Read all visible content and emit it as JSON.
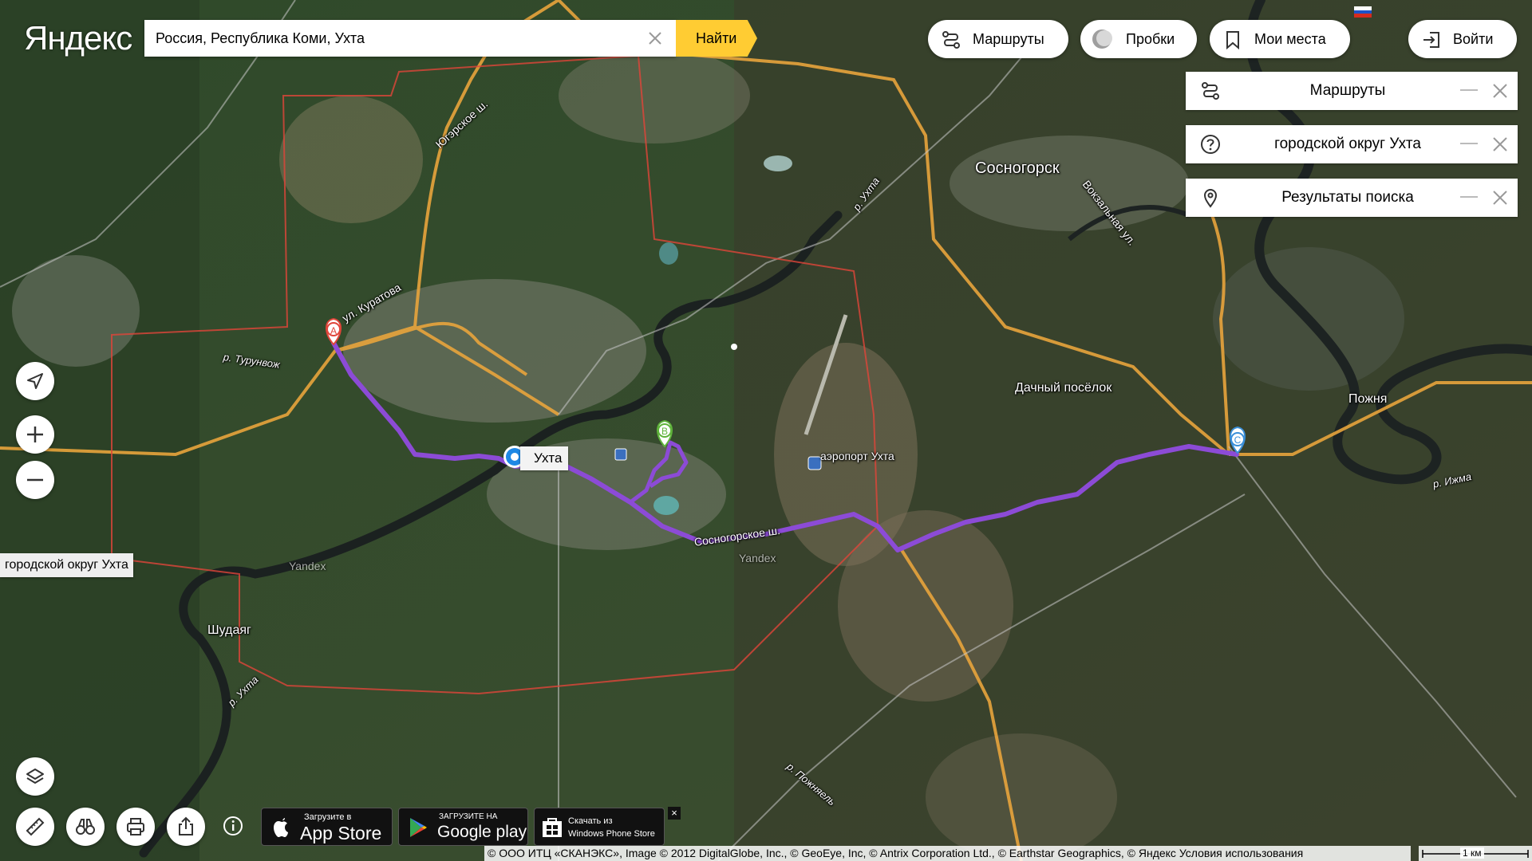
{
  "logo": "Яндекс",
  "search": {
    "value": "Россия, Республика Коми, Ухта",
    "button_label": "Найти"
  },
  "toolbar": {
    "routes_label": "Маршруты",
    "traffic_label": "Пробки",
    "myplaces_label": "Мои места",
    "login_label": "Войти"
  },
  "panels": [
    {
      "label": "Маршруты",
      "icon": "route-icon"
    },
    {
      "label": "городской округ Ухта",
      "icon": "question-icon"
    },
    {
      "label": "Результаты поиска",
      "icon": "pin-icon"
    }
  ],
  "map": {
    "mode": "satellite",
    "colors": {
      "route": "#8c4bd6",
      "road": "#e8a43c",
      "boundary": "#e0453a",
      "river": "#1b2120"
    },
    "city_pin_label": "Ухта",
    "region_label": "городской округ Ухта",
    "waypoints": [
      "A",
      "B",
      "C"
    ],
    "labels": {
      "sosnogorsk": "Сосногорск",
      "dachny": "Дачный посёлок",
      "pozhnya": "Пожня",
      "shudayag": "Шудаяг",
      "airport": "аэропорт Ухта",
      "kuratova": "ул. Куратова",
      "yugerskoe": "Югэрское ш.",
      "sosnogorskoe": "Сосногорское ш.",
      "vokzalnaya": "Вокзальная ул.",
      "turunvozh": "р. Турунвож",
      "ukhta_river1": "р. Ухта",
      "ukhta_river2": "р. Ухта",
      "izhma": "р. Ижма",
      "pozhnyael": "р. Пожняель",
      "yandex1": "Yandex",
      "yandex2": "Yandex"
    }
  },
  "stores": {
    "appstore_small": "Загрузите в",
    "appstore_big": "App Store",
    "googleplay_small": "ЗАГРУЗИТЕ НА",
    "googleplay_big": "Google play",
    "winphone_small": "Скачать из",
    "winphone_big": "Windows Phone Store",
    "close": "×"
  },
  "footer": {
    "copyright": "© ООО ИТЦ «СКАНЭКС», Image © 2012 DigitalGlobe, Inc., © GeoEye, Inc, © Antrix Corporation Ltd., © Earthstar Geographics, © Яндекс Условия использования",
    "scale_label": "1 км"
  }
}
